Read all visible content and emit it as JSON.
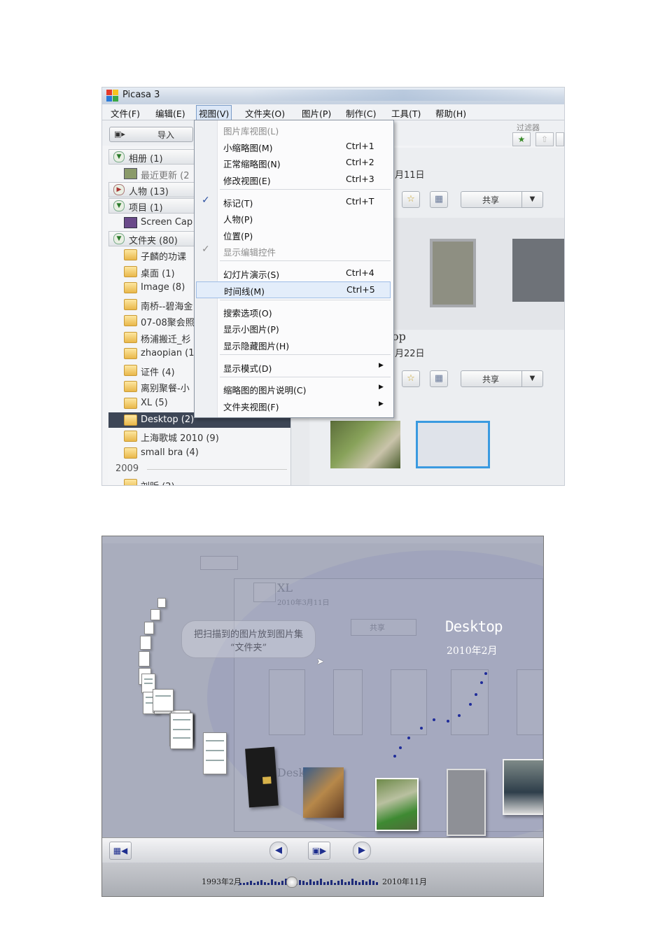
{
  "top_window": {
    "title": "Picasa 3",
    "menus": [
      "文件(F)",
      "编辑(E)",
      "视图(V)",
      "文件夹(O)",
      "图片(P)",
      "制作(C)",
      "工具(T)",
      "帮助(H)"
    ],
    "import_label": "导入",
    "filter_label": "过滤器",
    "sidebar": {
      "cat_albums": "相册 (1)",
      "recent": "最近更新 (2",
      "cat_people": "人物 (13)",
      "cat_projects": "项目 (1)",
      "screen_capture": "Screen Cap",
      "cat_folders": "文件夹 (80)",
      "folders": [
        "子麟的功课",
        "桌面 (1)",
        "Image (8)",
        "南桥--碧海金",
        "07-08聚会照",
        "杨浦搬迁_杉",
        "zhaopian (1",
        "证件 (4)",
        "离别聚餐-小",
        "XL (5)",
        "Desktop (2)",
        "上海歌城 2010 (9)",
        "small bra (4)"
      ],
      "year_2009": "2009",
      "cut_folder": "刘昕 (2)"
    },
    "main": {
      "date1": "月11日",
      "date2": "月22日",
      "title_frag": "op",
      "share_label": "共享"
    },
    "view_menu": [
      {
        "label": "图片库视图(L)",
        "shortcut": "",
        "disabled": true
      },
      {
        "label": "小缩略图(M)",
        "shortcut": "Ctrl+1"
      },
      {
        "label": "正常缩略图(N)",
        "shortcut": "Ctrl+2"
      },
      {
        "label": "修改视图(E)",
        "shortcut": "Ctrl+3"
      },
      {
        "label": "标记(T)",
        "shortcut": "Ctrl+T",
        "checked": true
      },
      {
        "label": "人物(P)",
        "shortcut": ""
      },
      {
        "label": "位置(P)",
        "shortcut": ""
      },
      {
        "label": "显示编辑控件",
        "shortcut": "",
        "checked": true,
        "disabled": true
      },
      {
        "label": "幻灯片演示(S)",
        "shortcut": "Ctrl+4"
      },
      {
        "label": "时间线(M)",
        "shortcut": "Ctrl+5",
        "highlighted": true
      },
      {
        "label": "搜索选项(O)",
        "shortcut": ""
      },
      {
        "label": "显示小图片(P)",
        "shortcut": ""
      },
      {
        "label": "显示隐藏图片(H)",
        "shortcut": ""
      },
      {
        "label": "显示模式(D)",
        "shortcut": "",
        "submenu": true
      },
      {
        "label": "缩略图的图片说明(C)",
        "shortcut": "",
        "submenu": true
      },
      {
        "label": "文件夹视图(F)",
        "shortcut": "",
        "submenu": true
      }
    ]
  },
  "bottom_window": {
    "bubble_line1": "把扫描到的图片放到图片集",
    "bubble_line2": "“文件夹”",
    "current_title": "Desktop",
    "current_date": "2010年2月",
    "ghost_folder": "XL",
    "ghost_date": "2010年3月11日",
    "ghost_share": "共享",
    "ghost_desk": "Desk",
    "timeline_start": "1993年2月",
    "timeline_end": "2010年11月",
    "timeline_position": 0.37
  },
  "colors": {
    "selection": "#3d4656",
    "menu_highlight": "#e3edfa",
    "timeline_accent": "#1f2c7a",
    "overlay": "#a9adbd"
  }
}
